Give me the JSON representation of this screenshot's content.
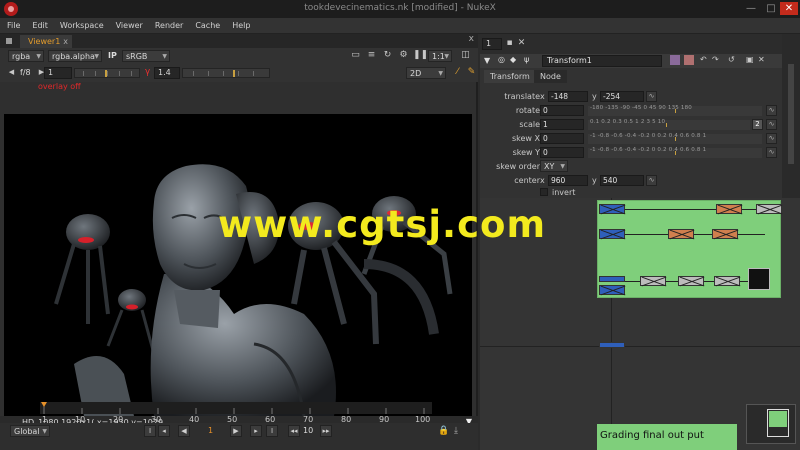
{
  "window": {
    "title": "tookdevecinematics.nk [modified] - NukeX",
    "minimize": "—",
    "maximize": "□",
    "close": "✕"
  },
  "menu": [
    "File",
    "Edit",
    "Workspace",
    "Viewer",
    "Render",
    "Cache",
    "Help"
  ],
  "viewer": {
    "tab_label": "Viewer1",
    "tab_close": "x",
    "panel_close": "x",
    "channels": "rgba",
    "alpha_channel": "rgba.alpha",
    "ip_label": "IP",
    "colorspace": "sRGB",
    "zoom": "1:1",
    "fstop": "f/8",
    "gain_value": "1",
    "gamma_value": "1.4",
    "view_mode": "2D",
    "overlay_message": "overlay off",
    "format_info": "HD_1080 1920x1(  x=1930 y=1029",
    "gain_ticks": [
      "0.03125",
      "0.125"
    ]
  },
  "timeline": {
    "frame_start": "1",
    "frame_end": "100",
    "ticks": [
      "1",
      "10",
      "20",
      "30",
      "40",
      "50",
      "60",
      "70",
      "80",
      "90",
      "100"
    ],
    "current_frame": "1",
    "global_label": "Global",
    "step_value": "10"
  },
  "properties": {
    "panel_count": "1",
    "node_name": "Transform1",
    "tabs": [
      "Transform",
      "Node"
    ],
    "translate": {
      "label": "translate",
      "x": "-148",
      "y": "-254"
    },
    "rotate": {
      "label": "rotate",
      "value": "0",
      "ticks": "-180  -135  -90  -45  0  45  90  135  180"
    },
    "scale": {
      "label": "scale",
      "value": "1",
      "ticks": "0.1  0.2  0.3  0.5  1  2  3  5  10",
      "badge": "2"
    },
    "skew_x": {
      "label": "skew X",
      "value": "0",
      "ticks": "-1  -0.8  -0.6  -0.4  -0.2  0  0.2  0.4  0.6  0.8  1"
    },
    "skew_y": {
      "label": "skew Y",
      "value": "0",
      "ticks": "-1  -0.8  -0.6  -0.4  -0.2  0  0.2  0.4  0.6  0.8  1"
    },
    "skew_order": {
      "label": "skew order",
      "value": "XY"
    },
    "center": {
      "label": "center",
      "x": "960",
      "y": "540"
    },
    "invert": {
      "label": "invert"
    }
  },
  "nodegraph": {
    "grading_label": "Grading final out put"
  },
  "watermark": "www.cgtsj.com"
}
